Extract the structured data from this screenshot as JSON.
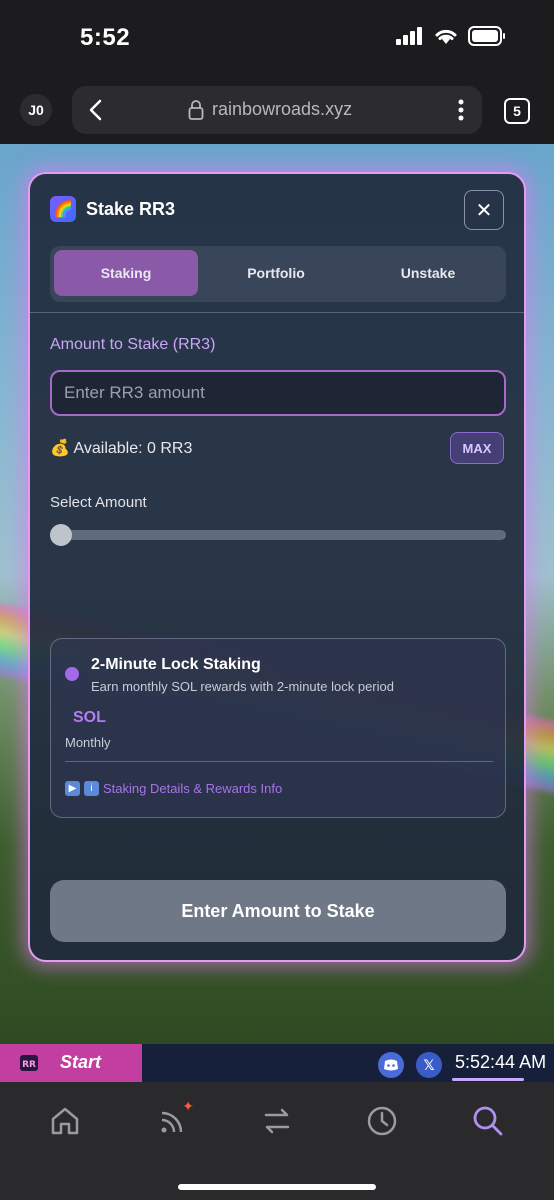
{
  "status_bar": {
    "time": "5:52"
  },
  "browser": {
    "profile_initials": "J0",
    "url": "rainbowroads.xyz",
    "tab_count": "5"
  },
  "modal": {
    "title": "Stake RR3",
    "close_label": "✕",
    "tabs": [
      {
        "label": "Staking",
        "active": true
      },
      {
        "label": "Portfolio",
        "active": false
      },
      {
        "label": "Unstake",
        "active": false
      }
    ],
    "amount_label": "Amount to Stake (RR3)",
    "amount_placeholder": "Enter RR3 amount",
    "amount_value": "",
    "available_icon": "💰",
    "available_text": "Available: 0 RR3",
    "max_label": "MAX",
    "select_amount_label": "Select Amount",
    "slider_value": 0,
    "option": {
      "title": "2-Minute Lock Staking",
      "description": "Earn monthly SOL rewards with 2-minute lock period",
      "reward_token": "SOL",
      "reward_period": "Monthly",
      "details_link": "Staking Details & Rewards Info"
    },
    "submit_label": "Enter Amount to Stake"
  },
  "taskbar": {
    "start_label": "Start",
    "x_label": "𝕏",
    "clock": "5:52:44 AM"
  },
  "bottom_nav": {
    "items": [
      "home-icon",
      "feed-icon",
      "swap-icon",
      "history-icon",
      "search-icon"
    ],
    "active": "search-icon"
  },
  "colors": {
    "accent": "#8a5aa8",
    "glow": "#e59cf0",
    "link": "#a873e8",
    "start_bg": "#c23ea0"
  }
}
